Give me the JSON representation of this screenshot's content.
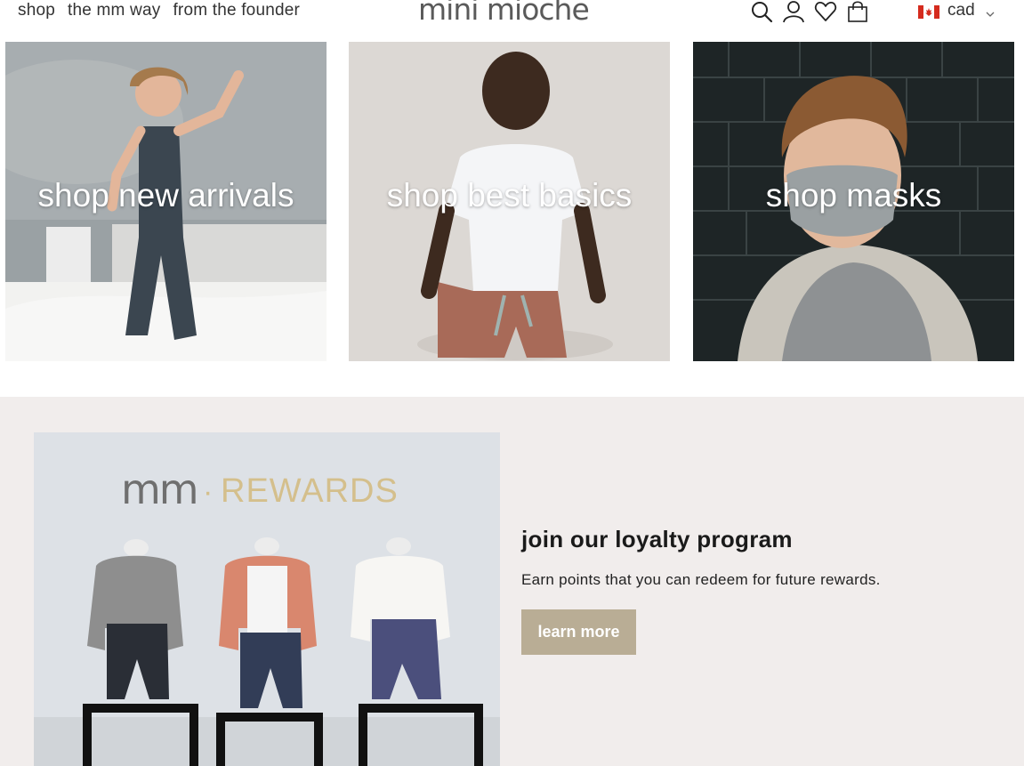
{
  "header": {
    "nav": [
      "shop",
      "the mm way",
      "from the founder"
    ],
    "logo": "mini mioche",
    "icons": [
      "search-icon",
      "account-icon",
      "wishlist-icon",
      "cart-icon"
    ],
    "currency": "cad"
  },
  "tiles": [
    {
      "label": "shop new arrivals"
    },
    {
      "label": "shop best basics"
    },
    {
      "label": "shop masks"
    }
  ],
  "loyalty": {
    "image_text": {
      "brand": "mm",
      "separator": "·",
      "word": "REWARDS"
    },
    "title": "join our loyalty program",
    "description": "Earn points that you can redeem for future rewards.",
    "button": "learn more"
  },
  "colors": {
    "section_bg": "#f1edec",
    "button_bg": "#b9ad95",
    "text_dark": "#1a1a1a"
  }
}
